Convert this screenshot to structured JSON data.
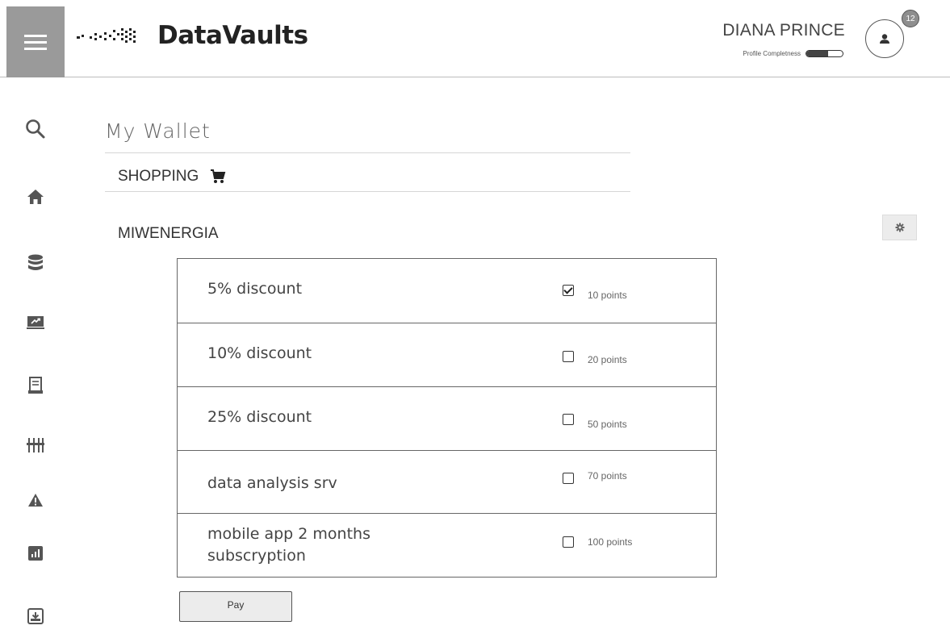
{
  "app": {
    "logo_text": "DataVaults"
  },
  "header": {
    "user_name": "DIANA PRINCE",
    "profile_completeness_label": "Profile Completness",
    "profile_completeness": 0.6,
    "notification_count": "12"
  },
  "sidebar": {
    "items": [
      {
        "icon": "search-icon"
      },
      {
        "icon": "home-icon"
      },
      {
        "icon": "database-icon"
      },
      {
        "icon": "presentation-icon"
      },
      {
        "icon": "document-icon"
      },
      {
        "icon": "sliders-icon"
      },
      {
        "icon": "warning-icon"
      },
      {
        "icon": "chart-icon"
      },
      {
        "icon": "download-box-icon"
      }
    ]
  },
  "main": {
    "title": "My Wallet",
    "section_label": "SHOPPING",
    "store_name": "MIWENERGIA",
    "offers": [
      {
        "label": "5% discount",
        "points": "10 points",
        "checked": true
      },
      {
        "label": "10% discount",
        "points": "20 points",
        "checked": false
      },
      {
        "label": "25% discount",
        "points": "50 points",
        "checked": false
      },
      {
        "label": "data analysis srv",
        "points": "70 points",
        "checked": false
      },
      {
        "label": "mobile app 2 months subscryption",
        "points": "100 points",
        "checked": false
      }
    ],
    "pay_label": "Pay"
  }
}
